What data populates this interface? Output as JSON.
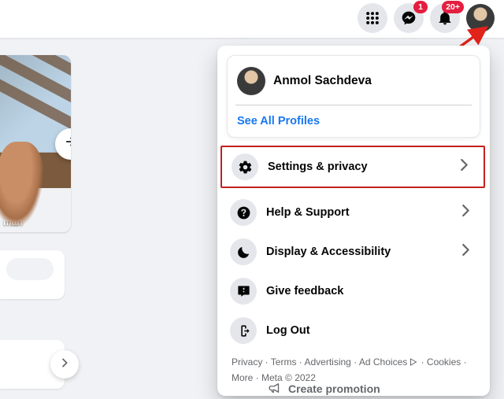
{
  "header": {
    "messenger_badge": "1",
    "notifications_badge": "20+"
  },
  "story": {
    "caption": "man"
  },
  "panel": {
    "profile_name": "Anmol Sachdeva",
    "see_all": "See All Profiles",
    "menu": {
      "settings": "Settings & privacy",
      "help": "Help & Support",
      "display": "Display & Accessibility",
      "feedback": "Give feedback",
      "logout": "Log Out"
    },
    "footer": {
      "privacy": "Privacy",
      "terms": "Terms",
      "advertising": "Advertising",
      "ad_choices": "Ad Choices",
      "cookies": "Cookies",
      "more": "More",
      "meta": "Meta © 2022"
    }
  },
  "promo": "Create promotion"
}
